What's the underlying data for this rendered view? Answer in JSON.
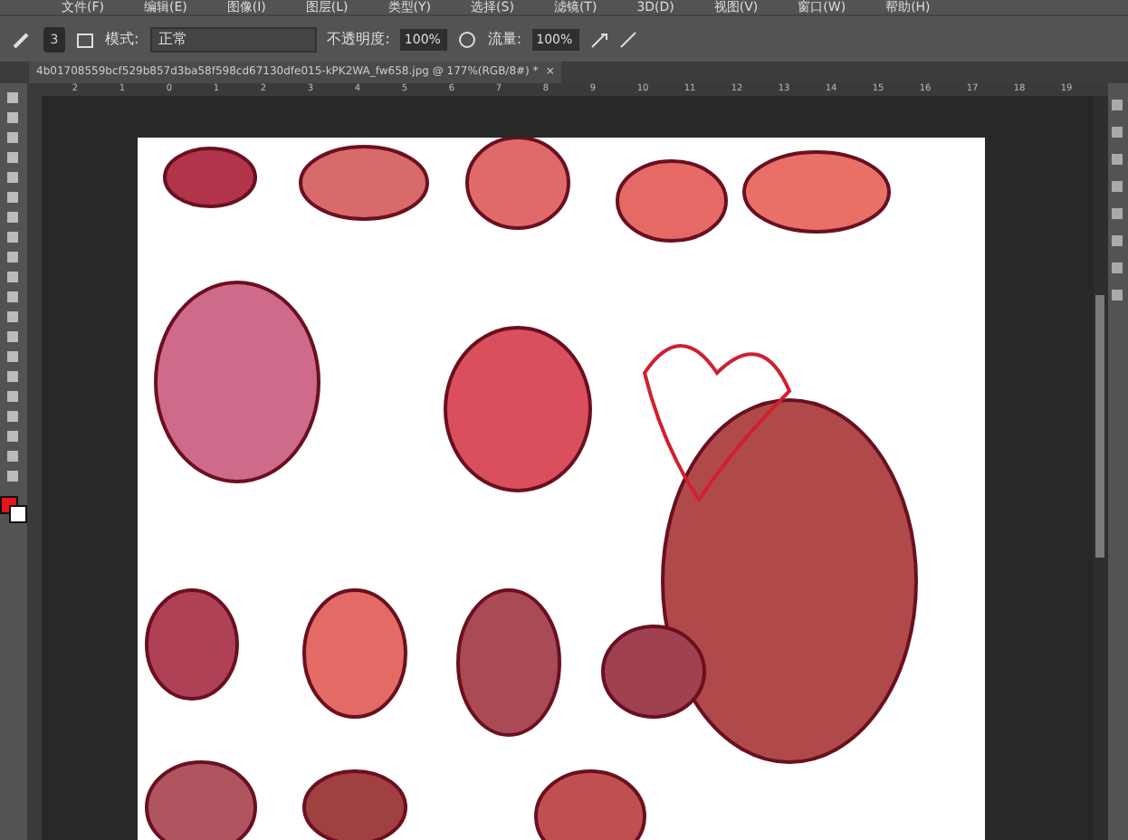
{
  "menu_bar": {
    "items": [
      "文件(F)",
      "编辑(E)",
      "图像(I)",
      "图层(L)",
      "类型(Y)",
      "选择(S)",
      "滤镜(T)",
      "3D(D)",
      "视图(V)",
      "窗口(W)",
      "帮助(H)"
    ]
  },
  "options_bar": {
    "brush_size": "3",
    "mode_label": "模式:",
    "mode_value": "正常",
    "opacity_label": "不透明度:",
    "opacity_value": "100%",
    "flow_label": "流量:",
    "flow_value": "100%"
  },
  "document_tab": {
    "title": "4b01708559bcf529b857d3ba58f598cd67130dfe015-kPK2WA_fw658.jpg @ 177%(RGB/8#) *",
    "close": "×"
  },
  "ruler": {
    "ticks": [
      "2",
      "1",
      "0",
      "1",
      "2",
      "3",
      "4",
      "5",
      "6",
      "7",
      "8",
      "9",
      "10",
      "11",
      "12",
      "13",
      "14",
      "15",
      "16",
      "17",
      "18",
      "19"
    ]
  },
  "color_swatches": [
    {
      "color": "#e8141c"
    },
    {
      "color": "#ffffff"
    }
  ]
}
